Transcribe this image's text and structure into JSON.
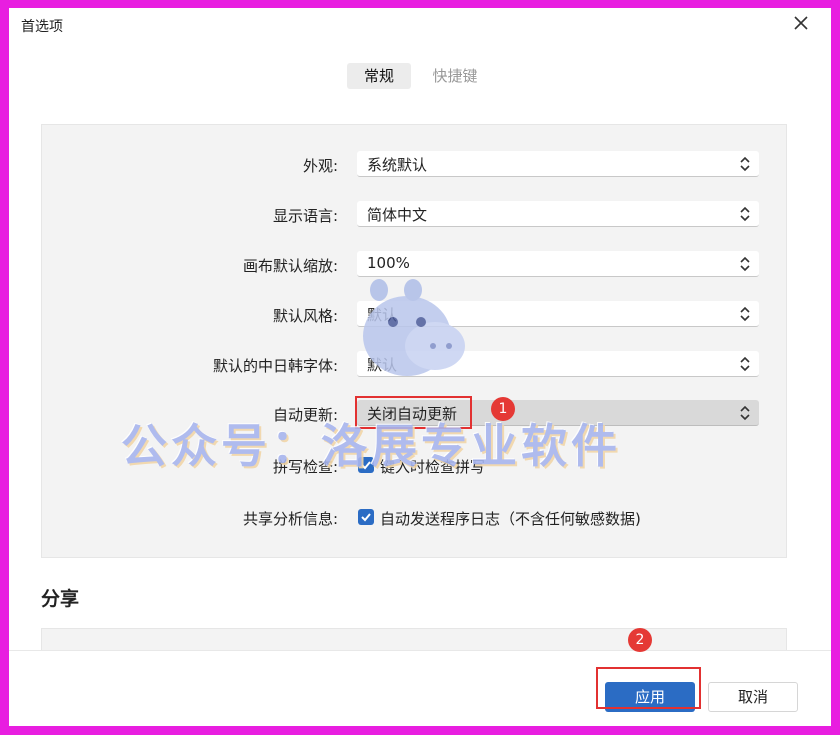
{
  "window": {
    "title": "首选项"
  },
  "tabs": [
    {
      "label": "常规",
      "active": true
    },
    {
      "label": "快捷键",
      "active": false
    }
  ],
  "settings": [
    {
      "label": "外观:",
      "value": "系统默认"
    },
    {
      "label": "显示语言:",
      "value": "简体中文"
    },
    {
      "label": "画布默认缩放:",
      "value": "100%"
    },
    {
      "label": "默认风格:",
      "value": "默认"
    },
    {
      "label": "默认的中日韩字体:",
      "value": "默认"
    },
    {
      "label": "自动更新:",
      "value": "关闭自动更新"
    }
  ],
  "checks": [
    {
      "label": "拼写检查:",
      "text": "键入时检查拼写",
      "checked": true
    },
    {
      "label": "共享分析信息:",
      "text": "自动发送程序日志（不含任何敏感数据)",
      "checked": true
    }
  ],
  "share": {
    "title": "分享"
  },
  "footer": {
    "apply": "应用",
    "cancel": "取消"
  },
  "annotations": {
    "badge1": "1",
    "badge2": "2"
  },
  "watermark": "公众号：洛展专业软件",
  "colors": {
    "accent": "#2b6cc4",
    "annotation_red": "#e53935",
    "frame": "#e81ee0"
  },
  "icons": {
    "close": "close-icon",
    "dropdown": "chevron-updown-icon",
    "check": "check-icon",
    "mascot": "hippo-mascot-icon"
  }
}
